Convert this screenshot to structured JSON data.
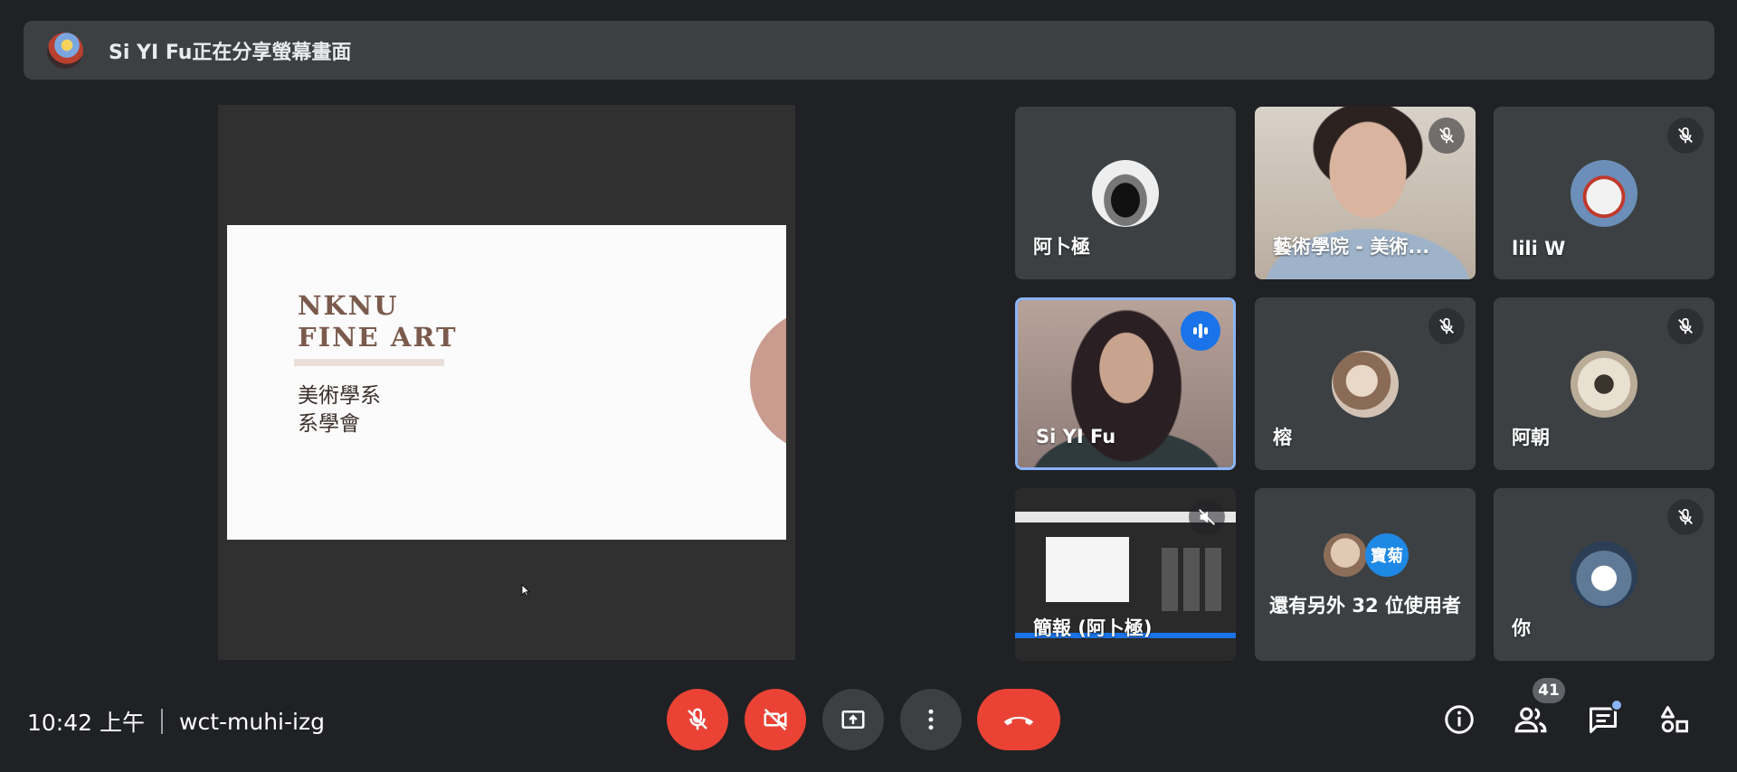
{
  "banner": {
    "text": "Si YI Fu正在分享螢幕畫面"
  },
  "presentation": {
    "slide_title": "NKNU\nFINE ART",
    "slide_subtitle": "美術學系\n系學會"
  },
  "participants": [
    {
      "name": "阿卜極",
      "muted": false,
      "type": "avatar"
    },
    {
      "name": "藝術學院 - 美術...",
      "muted": true,
      "type": "video"
    },
    {
      "name": "lili W",
      "muted": true,
      "type": "avatar"
    },
    {
      "name": "Si YI Fu",
      "muted": false,
      "speaking": true,
      "type": "video"
    },
    {
      "name": "榕",
      "muted": true,
      "type": "avatar"
    },
    {
      "name": "阿朝",
      "muted": true,
      "type": "avatar"
    },
    {
      "name": "簡報 (阿卜極)",
      "muted": true,
      "type": "presentation"
    },
    {
      "name": "還有另外 32 位使用者",
      "avatar_label": "寶菊",
      "type": "more"
    },
    {
      "name": "你",
      "muted": true,
      "type": "avatar"
    }
  ],
  "footer": {
    "time": "10:42 上午",
    "meeting_code": "wct-muhi-izg",
    "people_count": "41"
  },
  "colors": {
    "background": "#202124",
    "tile": "#3c4043",
    "danger": "#ea4335",
    "accent": "#8ab4f8",
    "speaking": "#1a73e8"
  },
  "icons": {
    "controls": [
      "mic-off-icon",
      "camera-off-icon",
      "present-icon",
      "more-icon",
      "hangup-icon"
    ],
    "right": [
      "info-icon",
      "people-icon",
      "chat-icon",
      "activities-icon"
    ]
  }
}
